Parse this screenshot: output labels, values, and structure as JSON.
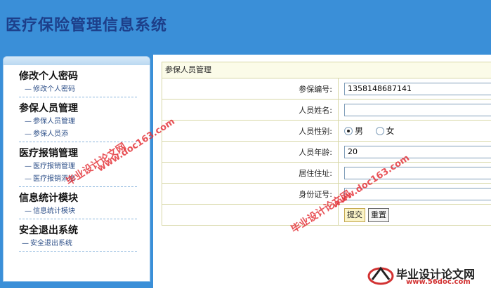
{
  "header": {
    "title": "医疗保险管理信息系统"
  },
  "sidebar": {
    "groups": [
      {
        "title": "修改个人密码",
        "items": [
          "修改个人密码"
        ]
      },
      {
        "title": "参保人员管理",
        "items": [
          "参保人员管理",
          "参保人员添"
        ]
      },
      {
        "title": "医疗报销管理",
        "items": [
          "医疗报销管理",
          "医疗报销添加"
        ]
      },
      {
        "title": "信息统计模块",
        "items": [
          "信息统计模块"
        ]
      },
      {
        "title": "安全退出系统",
        "items": [
          "安全退出系统"
        ]
      }
    ]
  },
  "panel": {
    "title": "参保人员管理",
    "fields": {
      "insure_no": {
        "label": "参保编号:",
        "value": "1358148687141"
      },
      "name": {
        "label": "人员姓名:",
        "value": ""
      },
      "gender": {
        "label": "人员性别:",
        "male": "男",
        "female": "女",
        "selected": "男"
      },
      "age": {
        "label": "人员年龄:",
        "value": "20"
      },
      "address": {
        "label": "居住住址:",
        "value": ""
      },
      "idcard": {
        "label": "身份证号:",
        "value": ""
      }
    },
    "submit_label": "提交",
    "reset_label": "重置"
  },
  "watermark": {
    "site": "www.doc163.com",
    "brand": "毕业设计论文网",
    "logo_text": "毕业设计论文网",
    "logo_url": "www.56doc.com"
  }
}
